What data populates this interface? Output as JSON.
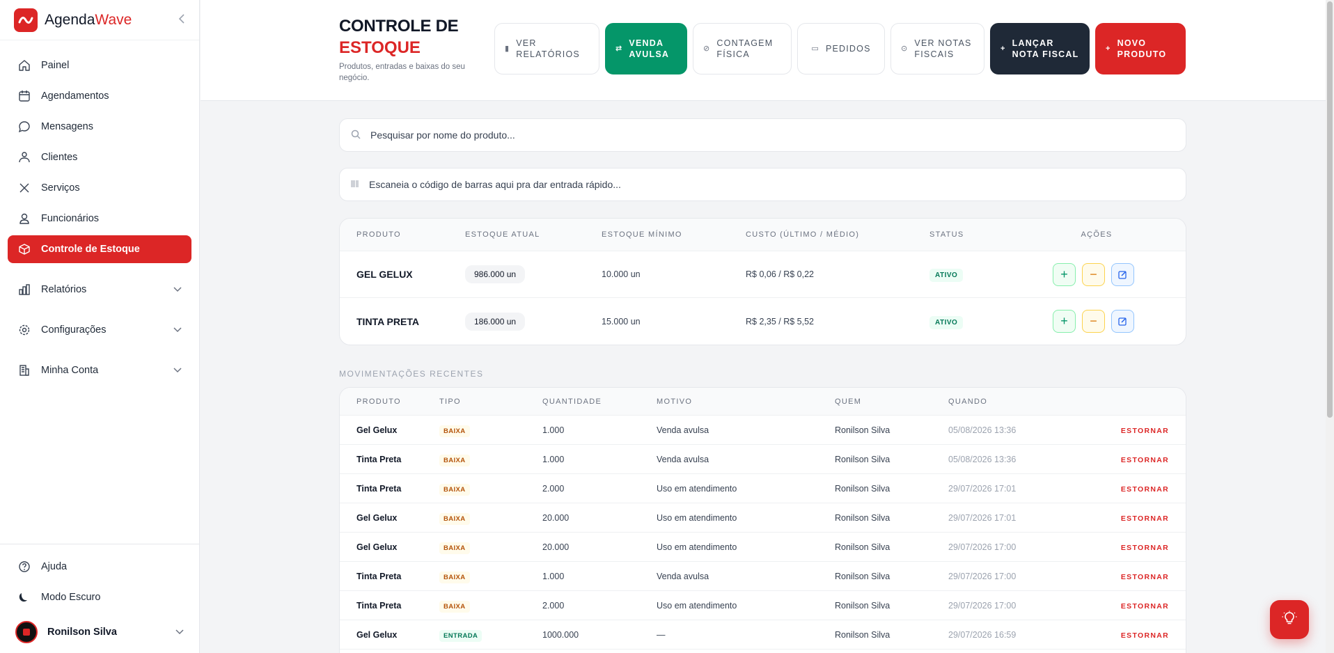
{
  "brand": {
    "name_a": "Agenda",
    "name_b": "Wave",
    "accent": "#dc2626"
  },
  "sidebar": {
    "items": [
      {
        "label": "Painel",
        "icon": "home-icon"
      },
      {
        "label": "Agendamentos",
        "icon": "calendar-icon"
      },
      {
        "label": "Mensagens",
        "icon": "chat-icon"
      },
      {
        "label": "Clientes",
        "icon": "users-icon"
      },
      {
        "label": "Serviços",
        "icon": "scissors-icon"
      },
      {
        "label": "Funcionários",
        "icon": "user-icon"
      },
      {
        "label": "Controle de Estoque",
        "icon": "box-icon",
        "active": true
      },
      {
        "label": "Relatórios",
        "icon": "chart-icon"
      },
      {
        "label": "Configurações",
        "icon": "gear-icon"
      },
      {
        "label": "Minha Conta",
        "icon": "building-icon"
      }
    ],
    "bottom": [
      {
        "label": "Ajuda",
        "icon": "help-icon"
      },
      {
        "label": "Modo Escuro",
        "icon": "moon-icon"
      }
    ],
    "user_name": "Ronilson Silva"
  },
  "header": {
    "title_line1": "CONTROLE DE",
    "title_line2": "ESTOQUE",
    "subtitle": "Produtos, entradas e baixas do seu negócio.",
    "buttons": [
      {
        "label": "VER RELATÓRIOS",
        "icon": "bar-chart-icon"
      },
      {
        "label": "VENDA AVULSA",
        "icon": "cart-icon"
      },
      {
        "label": "CONTAGEM FÍSICA",
        "icon": "check-circle-icon"
      },
      {
        "label": "PEDIDOS",
        "icon": "clipboard-icon"
      },
      {
        "label": "VER NOTAS FISCAIS",
        "icon": "receipt-icon"
      },
      {
        "label": "LANÇAR NOTA FISCAL",
        "icon": "plus-icon"
      },
      {
        "label": "NOVO PRODUTO",
        "icon": "plus-icon"
      }
    ]
  },
  "search": {
    "placeholder": "Pesquisar por nome do produto..."
  },
  "barcode": {
    "placeholder": "Escaneia o código de barras aqui pra dar entrada rápido..."
  },
  "products": {
    "headers": [
      "PRODUTO",
      "ESTOQUE ATUAL",
      "ESTOQUE MÍNIMO",
      "CUSTO (ÚLTIMO / MÉDIO)",
      "STATUS",
      "AÇÕES"
    ],
    "rows": [
      {
        "name": "GEL GELUX",
        "stock": "986.000 un",
        "min": "10.000 un",
        "cost": "R$ 0,06 / R$ 0,22",
        "status": "ATIVO"
      },
      {
        "name": "TINTA PRETA",
        "stock": "186.000 un",
        "min": "15.000 un",
        "cost": "R$ 2,35 / R$ 5,52",
        "status": "ATIVO"
      }
    ]
  },
  "movements": {
    "title": "MOVIMENTAÇÕES RECENTES",
    "headers": [
      "PRODUTO",
      "TIPO",
      "QUANTIDADE",
      "MOTIVO",
      "QUEM",
      "QUANDO"
    ],
    "undo_label": "ESTORNAR",
    "rows": [
      {
        "product": "Gel Gelux",
        "type": "BAIXA",
        "qty": "1.000",
        "reason": "Venda avulsa",
        "who": "Ronilson Silva",
        "when": "05/08/2026 13:36"
      },
      {
        "product": "Tinta Preta",
        "type": "BAIXA",
        "qty": "1.000",
        "reason": "Venda avulsa",
        "who": "Ronilson Silva",
        "when": "05/08/2026 13:36"
      },
      {
        "product": "Tinta Preta",
        "type": "BAIXA",
        "qty": "2.000",
        "reason": "Uso em atendimento",
        "who": "Ronilson Silva",
        "when": "29/07/2026 17:01"
      },
      {
        "product": "Gel Gelux",
        "type": "BAIXA",
        "qty": "20.000",
        "reason": "Uso em atendimento",
        "who": "Ronilson Silva",
        "when": "29/07/2026 17:01"
      },
      {
        "product": "Gel Gelux",
        "type": "BAIXA",
        "qty": "20.000",
        "reason": "Uso em atendimento",
        "who": "Ronilson Silva",
        "when": "29/07/2026 17:00"
      },
      {
        "product": "Tinta Preta",
        "type": "BAIXA",
        "qty": "1.000",
        "reason": "Venda avulsa",
        "who": "Ronilson Silva",
        "when": "29/07/2026 17:00"
      },
      {
        "product": "Tinta Preta",
        "type": "BAIXA",
        "qty": "2.000",
        "reason": "Uso em atendimento",
        "who": "Ronilson Silva",
        "when": "29/07/2026 17:00"
      },
      {
        "product": "Gel Gelux",
        "type": "ENTRADA",
        "qty": "1000.000",
        "reason": "—",
        "who": "Ronilson Silva",
        "when": "29/07/2026 16:59"
      }
    ]
  }
}
